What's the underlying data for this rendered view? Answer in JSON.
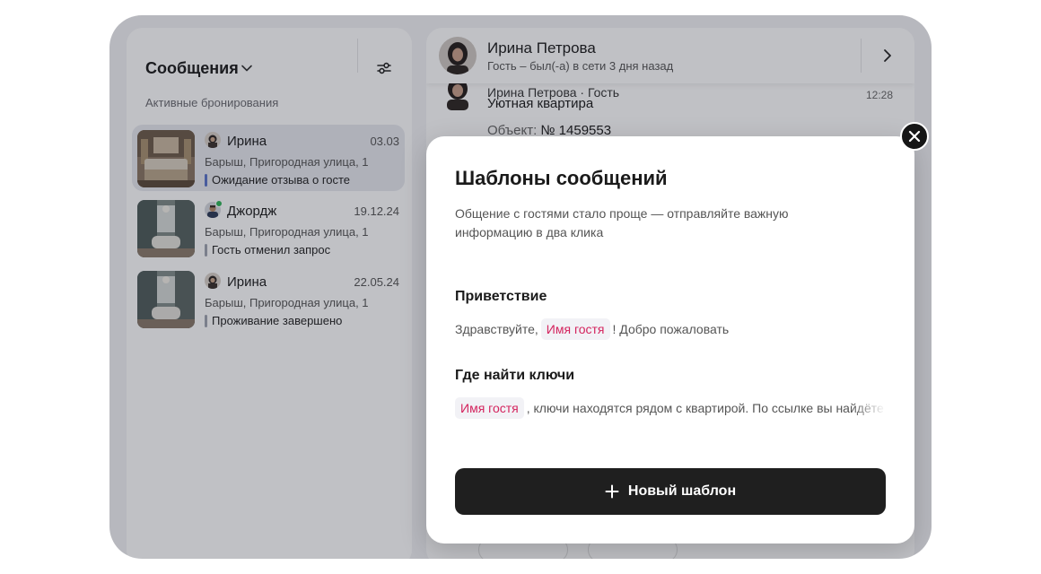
{
  "sidebar": {
    "title": "Сообщения",
    "section_label": "Активные бронирования",
    "chats": [
      {
        "name": "Ирина",
        "date": "03.03",
        "address": "Барыш, Пригородная улица, 1",
        "status": "Ожидание отзыва о госте",
        "status_color": "#5b73c9",
        "active": true
      },
      {
        "name": "Джордж",
        "date": "19.12.24",
        "address": "Барыш, Пригородная улица, 1",
        "status": "Гость отменил запрос",
        "status_color": "#a0a4b0",
        "online": true
      },
      {
        "name": "Ирина",
        "date": "22.05.24",
        "address": "Барыш, Пригородная улица, 1",
        "status": "Проживание завершено",
        "status_color": "#a0a4b0"
      }
    ]
  },
  "conversation": {
    "contact_name": "Ирина Петрова",
    "contact_status": "Гость – был(-а) в сети 3 дня назад",
    "message": {
      "sender": "Ирина Петрова · Гость",
      "time": "12:28",
      "title": "Уютная квартира",
      "object_label": "Объект:",
      "object_value": "№ 1459553"
    }
  },
  "modal": {
    "title": "Шаблоны сообщений",
    "description": "Общение с гостями стало проще — отправляйте важную информацию в два клика",
    "templates": [
      {
        "title": "Приветствие",
        "prefix": "Здравствуйте,",
        "variable": "Имя гостя",
        "suffix": "! Добро пожаловать"
      },
      {
        "title": "Где найти ключи",
        "prefix": "",
        "variable": "Имя гостя",
        "suffix": ", ключи находятся рядом с квартирой. По ссылке вы найдёте"
      }
    ],
    "new_button_label": "Новый шаблон"
  },
  "colors": {
    "accent_variable": "#d4245e",
    "button_dark": "#1f1f1f",
    "overlay": "rgba(30,34,48,0.28)"
  }
}
